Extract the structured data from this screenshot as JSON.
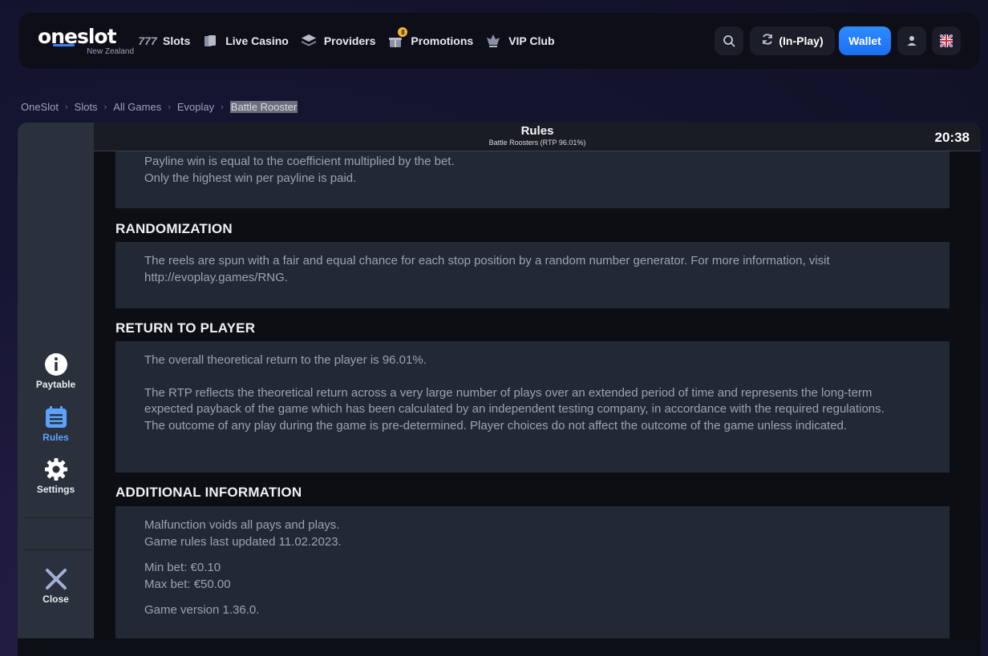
{
  "header": {
    "logo_text_pre": "o",
    "logo_text_accent": "ne",
    "logo_text_post": "slot",
    "logo_sub": "New Zealand",
    "nav": [
      {
        "label": "Slots",
        "icon": "sevens-icon"
      },
      {
        "label": "Live Casino",
        "icon": "cards-icon"
      },
      {
        "label": "Providers",
        "icon": "layers-icon"
      },
      {
        "label": "Promotions",
        "icon": "gift-icon",
        "badge": "8"
      },
      {
        "label": "VIP Club",
        "icon": "crown-icon"
      }
    ],
    "inplay_label": "(In-Play)",
    "wallet_label": "Wallet"
  },
  "breadcrumb": {
    "items": [
      "OneSlot",
      "Slots",
      "All Games",
      "Evoplay"
    ],
    "current": "Battle Rooster"
  },
  "game": {
    "sidebar": {
      "paytable": "Paytable",
      "rules": "Rules",
      "settings": "Settings",
      "close": "Close"
    },
    "rules_title": "Rules",
    "rules_subtitle": "Battle Roosters (RTP 96.01%)",
    "clock": "20:38",
    "sections": {
      "paylines": {
        "lines": [
          "Payline win is equal to the coefficient multiplied by the bet.",
          "Only the highest win per payline is paid."
        ]
      },
      "randomization": {
        "title": "RANDOMIZATION",
        "text": "The reels are spun with a fair and equal chance for each stop position by a random number generator. For more information, visit http://evoplay.games/RNG."
      },
      "rtp": {
        "title": "RETURN TO PLAYER",
        "p1": "The overall theoretical return to the player is 96.01%.",
        "p2": "The RTP reflects the theoretical return across a very large number of plays over an extended period of time and represents the long-term expected payback of the game which has been calculated by an independent testing company, in accordance with the required regulations.",
        "p3": "The outcome of any play during the game is pre-determined. Player choices do not affect the outcome of the game unless indicated."
      },
      "additional": {
        "title": "ADDITIONAL INFORMATION",
        "l1": "Malfunction voids all pays and plays.",
        "l2": "Game rules last updated 11.02.2023.",
        "min_bet": "Min bet: €0.10",
        "max_bet": "Max bet: €50.00",
        "version": "Game version 1.36.0."
      }
    }
  },
  "colors": {
    "accent": "#1a6ff2",
    "active_tab": "#5aa4ff",
    "card_bg": "#232934",
    "sidebar_bg": "#2b313c"
  }
}
